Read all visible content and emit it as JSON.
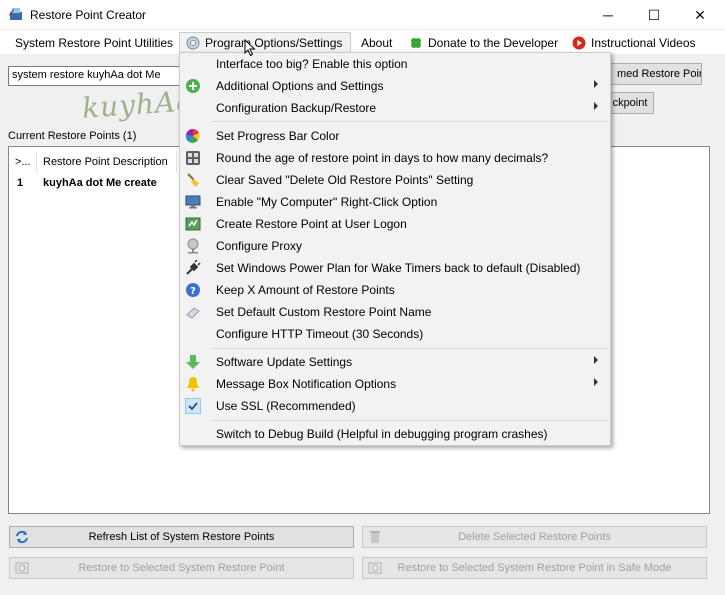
{
  "window": {
    "title": "Restore Point Creator",
    "minimize": "─",
    "maximize": "☐",
    "close": "✕"
  },
  "menubar": {
    "items": [
      {
        "label": "System Restore Point Utilities"
      },
      {
        "label": "Program Options/Settings"
      },
      {
        "label": "About"
      },
      {
        "label": "Donate to the Developer"
      },
      {
        "label": "Instructional Videos"
      }
    ]
  },
  "toolbar": {
    "description_value": "system restore kuyhAa dot Me",
    "named_restore_button": "med Restore Point",
    "checkpoint_button": "ckpoint"
  },
  "watermark": "kuyhAa.Me",
  "restore_points": {
    "group_label": "Current Restore Points (1)",
    "columns": [
      ">...",
      "Restore Point Description"
    ],
    "rows": [
      {
        "id": "1",
        "description": "kuyhAa dot Me create"
      }
    ]
  },
  "bottom_buttons": {
    "refresh": "Refresh List of System Restore Points",
    "delete": "Delete Selected Restore Points",
    "restore": "Restore to Selected System Restore Point",
    "restore_safe": "Restore to Selected System Restore Point in Safe Mode"
  },
  "dropdown": {
    "items": [
      {
        "label": "Interface too big? Enable this option",
        "icon": "none",
        "submenu": false
      },
      {
        "label": "Additional Options and Settings",
        "icon": "plus-icon",
        "submenu": true
      },
      {
        "label": "Configuration Backup/Restore",
        "icon": "none",
        "submenu": true
      },
      {
        "label": "Set Progress Bar Color",
        "icon": "color-wheel-icon",
        "submenu": false
      },
      {
        "label": "Round the age of restore point in days to how many decimals?",
        "icon": "grid-icon",
        "submenu": false
      },
      {
        "label": "Clear Saved \"Delete Old Restore Points\" Setting",
        "icon": "broom-icon",
        "submenu": false
      },
      {
        "label": "Enable \"My Computer\" Right-Click Option",
        "icon": "computer-icon",
        "submenu": false
      },
      {
        "label": "Create Restore Point at User Logon",
        "icon": "logon-icon",
        "submenu": false
      },
      {
        "label": "Configure Proxy",
        "icon": "proxy-icon",
        "submenu": false
      },
      {
        "label": "Set Windows Power Plan for Wake Timers back to default (Disabled)",
        "icon": "plug-icon",
        "submenu": false
      },
      {
        "label": "Keep X Amount of Restore Points",
        "icon": "info-icon",
        "submenu": false
      },
      {
        "label": "Set Default Custom Restore Point Name",
        "icon": "eraser-icon",
        "submenu": false
      },
      {
        "label": "Configure HTTP Timeout (30 Seconds)",
        "icon": "none",
        "submenu": false
      },
      {
        "label": "Software Update Settings",
        "icon": "download-arrow-icon",
        "submenu": true
      },
      {
        "label": "Message Box Notification Options",
        "icon": "bell-icon",
        "submenu": true
      },
      {
        "label": "Use SSL (Recommended)",
        "icon": "check-icon",
        "submenu": false
      },
      {
        "label": "Switch to Debug Build (Helpful in debugging program crashes)",
        "icon": "none",
        "submenu": false
      }
    ]
  },
  "colors": {
    "menu_bg": "#f2f2f2",
    "window_bg": "#f0f0f0",
    "button_bg": "#e1e1e1",
    "accent_green": "#4caf50",
    "check_bg": "#cce4f7"
  }
}
